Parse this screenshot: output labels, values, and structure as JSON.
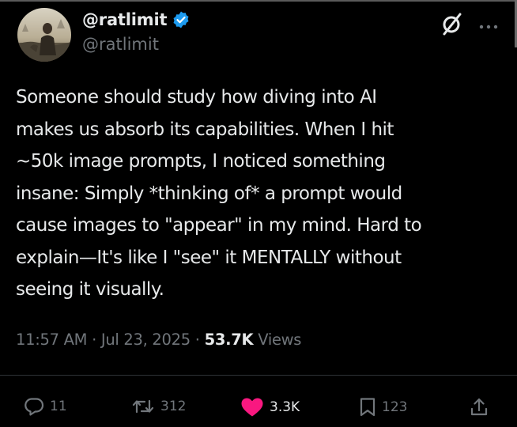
{
  "author": {
    "display_name": "@ratlimit",
    "handle": "@ratlimit",
    "verified": true
  },
  "tweet": {
    "lines": [
      "Someone should study how diving into AI",
      "makes us absorb its capabilities. When I hit",
      "~50k image prompts, I noticed something",
      "insane: Simply *thinking of* a prompt would",
      "cause images to \"appear\" in my mind. Hard to",
      "explain—It's like I \"see\" it MENTALLY without",
      "seeing it visually."
    ]
  },
  "meta": {
    "time": "11:57 AM",
    "date": "Jul 23, 2025",
    "views_count": "53.7K",
    "views_label": "Views"
  },
  "actions": {
    "replies": "11",
    "reposts": "312",
    "likes": "3.3K",
    "bookmarks": "123"
  },
  "icons": {
    "verified": "verified-badge-icon",
    "grok": "grok-icon",
    "more": "more-options-icon",
    "reply": "reply-icon",
    "repost": "repost-icon",
    "like": "heart-icon",
    "bookmark": "bookmark-icon",
    "share": "share-icon"
  },
  "colors": {
    "background": "#000000",
    "text": "#e7e9ea",
    "muted": "#71767b",
    "verified": "#1d9bf0",
    "like": "#f91880"
  }
}
